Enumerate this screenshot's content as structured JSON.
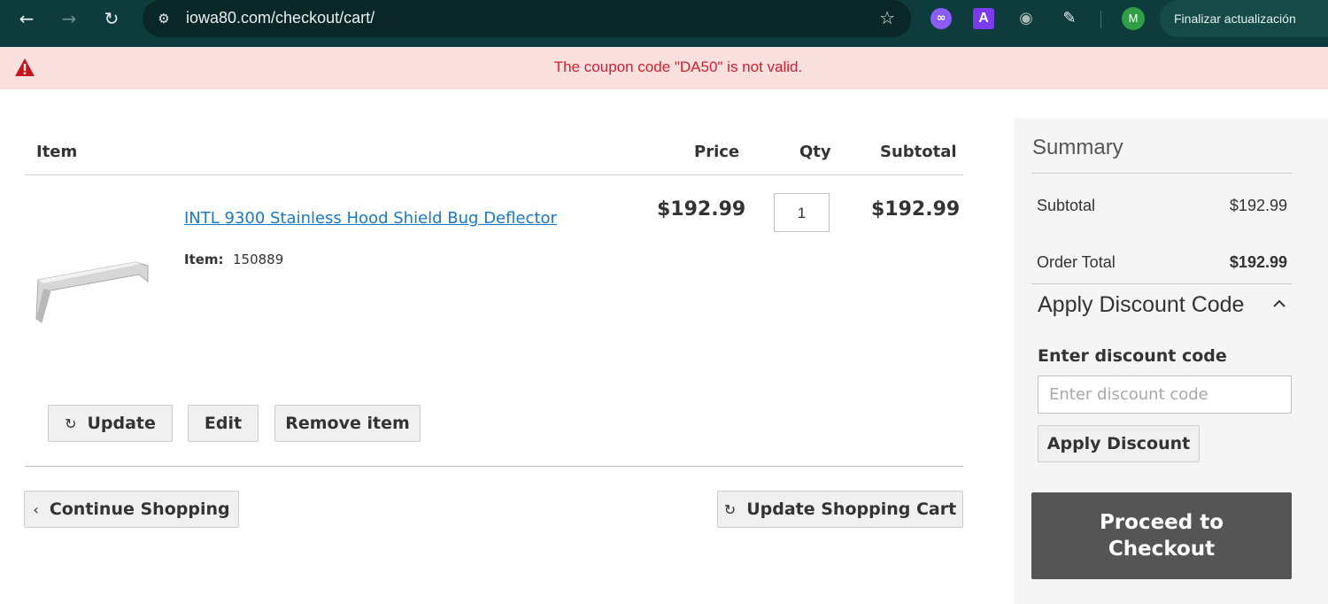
{
  "browser": {
    "url": "iowa80.com/checkout/cart/",
    "profile_initial": "M",
    "update_label": "Finalizar actualización",
    "ext_a_label": "A"
  },
  "alert": {
    "message": "The coupon code \"DA50\" is not valid.",
    "color": "#d0202e",
    "background": "#fbe0e0"
  },
  "cart": {
    "headers": {
      "item": "Item",
      "price": "Price",
      "qty": "Qty",
      "subtotal": "Subtotal"
    },
    "items": [
      {
        "name": "INTL 9300 Stainless Hood Shield Bug Deflector",
        "sku_label": "Item:",
        "sku": "150889",
        "price": "$192.99",
        "qty": "1",
        "subtotal": "$192.99"
      }
    ],
    "actions": {
      "update": "Update",
      "edit": "Edit",
      "remove": "Remove item"
    },
    "continue_label": "Continue Shopping",
    "update_cart_label": "Update Shopping Cart"
  },
  "summary": {
    "title": "Summary",
    "subtotal_label": "Subtotal",
    "subtotal_value": "$192.99",
    "order_total_label": "Order Total",
    "order_total_value": "$192.99",
    "discount": {
      "title": "Apply Discount Code",
      "field_label": "Enter discount code",
      "placeholder": "Enter discount code",
      "apply_label": "Apply Discount"
    },
    "checkout_label": "Proceed to Checkout"
  }
}
